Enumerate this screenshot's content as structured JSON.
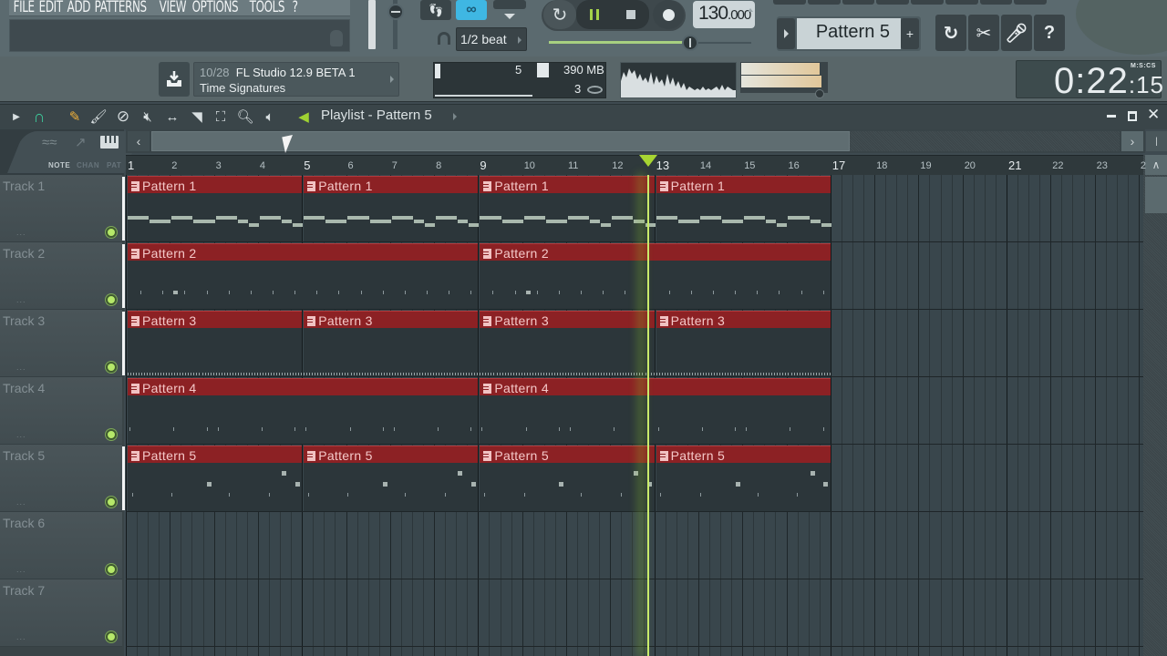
{
  "menu": [
    "FILE",
    "EDIT",
    "ADD",
    "PATTERNS",
    "VIEW",
    "OPTIONS",
    "TOOLS",
    "?"
  ],
  "snap": {
    "value": "1/2 beat"
  },
  "transport": {
    "tempo_int": "130",
    "tempo_dec": ".000",
    "state": "playing",
    "master_pitch_level": 0.7
  },
  "pattern_selector": {
    "value": "Pattern 5",
    "add_label": "+"
  },
  "toolbar_icons": [
    "undo-icon",
    "cut-icon",
    "mic-icon",
    "help-icon"
  ],
  "news": {
    "count": "10/28",
    "title": "FL Studio 12.9 BETA 1",
    "subtitle": "Time Signatures"
  },
  "monitor": {
    "cpu": "5",
    "ram": "390 MB",
    "polyphony": "3"
  },
  "clock": {
    "main": "0:22",
    "cs": "15",
    "format": "M:S:CS"
  },
  "playlist": {
    "title": "Playlist - Pattern 5",
    "side_tabs": [
      "NOTE",
      "CHAN",
      "PAT"
    ],
    "ruler": [
      "1",
      "2",
      "3",
      "4",
      "5",
      "6",
      "7",
      "8",
      "9",
      "10",
      "11",
      "12",
      "13",
      "14",
      "15",
      "16",
      "17",
      "18",
      "19",
      "20",
      "21",
      "22",
      "23",
      "2"
    ],
    "playhead_bar": 12.85,
    "tracks": [
      {
        "name": "Track 1",
        "clips": [
          {
            "label": "Pattern 1",
            "start": 1,
            "len": 4
          },
          {
            "label": "Pattern 1",
            "start": 5,
            "len": 4
          },
          {
            "label": "Pattern 1",
            "start": 9,
            "len": 4
          },
          {
            "label": "Pattern 1",
            "start": 13,
            "len": 4
          }
        ],
        "content": "melody"
      },
      {
        "name": "Track 2",
        "clips": [
          {
            "label": "Pattern 2",
            "start": 1,
            "len": 8
          },
          {
            "label": "Pattern 2",
            "start": 9,
            "len": 8
          }
        ],
        "content": "hats"
      },
      {
        "name": "Track 3",
        "clips": [
          {
            "label": "Pattern 3",
            "start": 1,
            "len": 4
          },
          {
            "label": "Pattern 3",
            "start": 5,
            "len": 4
          },
          {
            "label": "Pattern 3",
            "start": 9,
            "len": 4
          },
          {
            "label": "Pattern 3",
            "start": 13,
            "len": 4
          }
        ],
        "content": "ticks"
      },
      {
        "name": "Track 4",
        "clips": [
          {
            "label": "Pattern 4",
            "start": 1,
            "len": 8
          },
          {
            "label": "Pattern 4",
            "start": 9,
            "len": 8
          }
        ],
        "content": "sparse"
      },
      {
        "name": "Track 5",
        "clips": [
          {
            "label": "Pattern 5",
            "start": 1,
            "len": 4
          },
          {
            "label": "Pattern 5",
            "start": 5,
            "len": 4
          },
          {
            "label": "Pattern 5",
            "start": 9,
            "len": 4
          },
          {
            "label": "Pattern 5",
            "start": 13,
            "len": 4
          }
        ],
        "content": "dots"
      },
      {
        "name": "Track 6",
        "clips": []
      },
      {
        "name": "Track 7",
        "clips": []
      }
    ]
  },
  "colors": {
    "clip": "#8c2124",
    "playhead": "#a7d532",
    "accent_link": "#3fb7e3"
  }
}
